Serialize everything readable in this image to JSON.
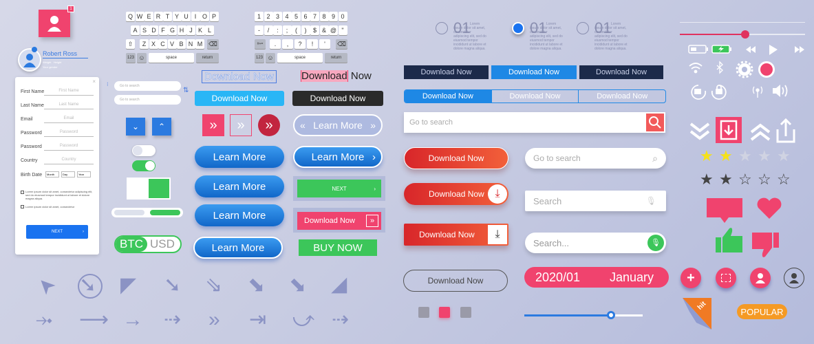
{
  "profile": {
    "badge": "1",
    "name": "Robert Ross",
    "weight": "Weight",
    "height": "Height",
    "gender": "Your gender"
  },
  "form": {
    "close": "×",
    "fields": [
      {
        "label": "First Name",
        "placeholder": "First Name"
      },
      {
        "label": "Last Name",
        "placeholder": "Last Name"
      },
      {
        "label": "Email",
        "placeholder": "Email"
      },
      {
        "label": "Password",
        "placeholder": "Password"
      },
      {
        "label": "Password",
        "placeholder": "Password"
      },
      {
        "label": "Country",
        "placeholder": "Country"
      }
    ],
    "birth_label": "Birth Date",
    "month": "Month",
    "day": "Day",
    "year": "Year",
    "check1": "Lorem ipsum dolor sit amet, consectetur adipiscing elit, sed do eiusmod tempor incididunt ut labore et dolore magna aliqua.",
    "check2": "Lorem ipsum dolor sit amet, consectetur",
    "next": "NEXT"
  },
  "keyboard_alpha": {
    "row1": [
      "Q",
      "W",
      "E",
      "R",
      "T",
      "Y",
      "U",
      "I",
      "O",
      "P"
    ],
    "row2": [
      "A",
      "S",
      "D",
      "F",
      "G",
      "H",
      "J",
      "K",
      "L"
    ],
    "row3": [
      "Z",
      "X",
      "C",
      "V",
      "B",
      "N",
      "M"
    ],
    "num": "123",
    "space": "space",
    "return": "return"
  },
  "keyboard_num": {
    "row1": [
      "1",
      "2",
      "3",
      "4",
      "5",
      "6",
      "7",
      "8",
      "9",
      "0"
    ],
    "row2": [
      "-",
      "/",
      ":",
      ";",
      "(",
      ")",
      "$",
      "&",
      "@",
      "\""
    ],
    "row3": [
      ".",
      ",",
      "?",
      "!",
      "'"
    ],
    "sym": "#+=",
    "num": "123",
    "space": "space",
    "return": "return"
  },
  "search_small": {
    "placeholder1": "Go to search",
    "placeholder2": "Go to search"
  },
  "text_edit": {
    "outlined": "Download Now",
    "selected_part": "Download",
    "rest": " Now"
  },
  "buttons": {
    "download_cyan": "Download Now",
    "download_dark": "Download Now",
    "learn_more": "Learn More",
    "next": "NEXT",
    "download_pink": "Download Now",
    "buy_now": "BUY NOW",
    "btc": "BTC",
    "usd": "USD"
  },
  "steps": [
    {
      "num": "01",
      "text": "Lorem ipsum dolor sit amet, consectetur adipiscing elit, sed do eiusmod tempor incididunt ut labore et dolore magna aliqua."
    },
    {
      "num": "01",
      "text": "Lorem ipsum dolor sit amet, consectetur adipiscing elit, sed do eiusmod tempor incididunt ut labore et dolore magna aliqua."
    },
    {
      "num": "01",
      "text": "Lorem ipsum dolor sit amet, consectetur adipiscing elit, sed do eiusmod tempor incididunt ut labore et dolore magna aliqua."
    }
  ],
  "tabs": [
    "Download Now",
    "Download Now",
    "Download Now"
  ],
  "segmented": [
    "Download Now",
    "Download Now",
    "Download Now"
  ],
  "search_bar": {
    "placeholder": "Go to search"
  },
  "red_buttons": [
    "Download Now",
    "Download Now",
    "Download Now"
  ],
  "search_pills": [
    "Go to search",
    "Search",
    "Search..."
  ],
  "outline_pill": "Download Now",
  "date": {
    "value": "2020/01",
    "month": "January"
  },
  "media": {
    "volume_level": 0.52
  },
  "slider": {
    "value": 0.73
  },
  "ratings": {
    "filled": 2,
    "total": 5,
    "dark_filled": 2
  },
  "badges": {
    "hit": "hit",
    "popular": "POPULAR"
  },
  "colors": {
    "accent_pink": "#f0436e",
    "blue": "#1e88e5",
    "green": "#3cc65a",
    "red": "#e0302f",
    "navy": "#1c2a4a"
  }
}
